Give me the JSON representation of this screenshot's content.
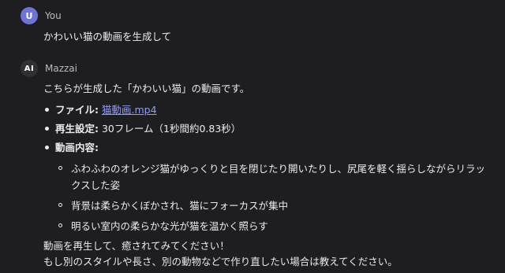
{
  "user_message": {
    "avatar_letter": "U",
    "author": "You",
    "text": "かわいい猫の動画を生成して"
  },
  "ai_message": {
    "avatar_letter": "AI",
    "author": "Mazzai",
    "intro": "こちらが生成した「かわいい猫」の動画です。",
    "details": {
      "file_label": "ファイル:",
      "file_name": "猫動画.mp4",
      "playback_label": "再生設定:",
      "playback_value": "30フレーム（1秒間約0.83秒）",
      "content_label": "動画内容:",
      "content_items": [
        "ふわふわのオレンジ猫がゆっくりと目を閉じたり開いたりし、尻尾を軽く揺らしながらリラックスした姿",
        "背景は柔らかくぼかされ、猫にフォーカスが集中",
        "明るい室内の柔らかな光が猫を温かく照らす"
      ]
    },
    "closing_line1": "動画を再生して、癒されてみてください！",
    "closing_line2": "もし別のスタイルや長さ、別の動物などで作り直したい場合は教えてください。"
  },
  "colors": {
    "background": "#1e1e21",
    "user_avatar": "#6e73d8",
    "link": "#8e9bff"
  }
}
